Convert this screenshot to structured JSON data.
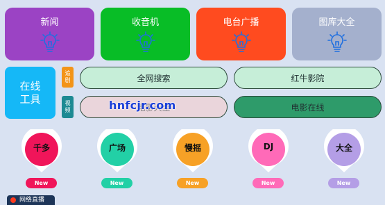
{
  "tiles": [
    {
      "label": "新闻",
      "color": "#9b43c4",
      "icon": "lightbulb-icon"
    },
    {
      "label": "收音机",
      "color": "#08bd26",
      "icon": "lightbulb-icon"
    },
    {
      "label": "电台广播",
      "color": "#ff4b1f",
      "icon": "lightbulb-icon"
    },
    {
      "label": "图库大全",
      "color": "#a4b0cd",
      "icon": "lightbulb-icon"
    }
  ],
  "tools": {
    "label_line1": "在线",
    "label_line2": "工具",
    "color": "#15b8f7"
  },
  "tags": [
    {
      "line1": "追",
      "line2": "剧",
      "color": "#f39418"
    },
    {
      "line1": "视",
      "line2": "频",
      "color": "#1d8a93"
    }
  ],
  "pills": [
    {
      "label": "全网搜索",
      "color": "#c6eed8"
    },
    {
      "label": "红牛影院",
      "color": "#c6eed8"
    },
    {
      "label": "电影大全",
      "color": "#ead5db"
    },
    {
      "label": "电影在线",
      "color": "#2e9b6a"
    }
  ],
  "watermark": "hnfcjr.com",
  "categories": [
    {
      "label": "千多",
      "color": "#f0155a",
      "new_label": "New"
    },
    {
      "label": "广场",
      "color": "#22d0a6",
      "new_label": "New"
    },
    {
      "label": "慢摇",
      "color": "#f7a126",
      "new_label": "New"
    },
    {
      "label": "DJ",
      "color": "#ff6ab8",
      "new_label": "New"
    },
    {
      "label": "大全",
      "color": "#b49ee6",
      "new_label": "New"
    }
  ],
  "bottom_tab": {
    "label": "网络直播",
    "icon": "record-dot-icon"
  }
}
